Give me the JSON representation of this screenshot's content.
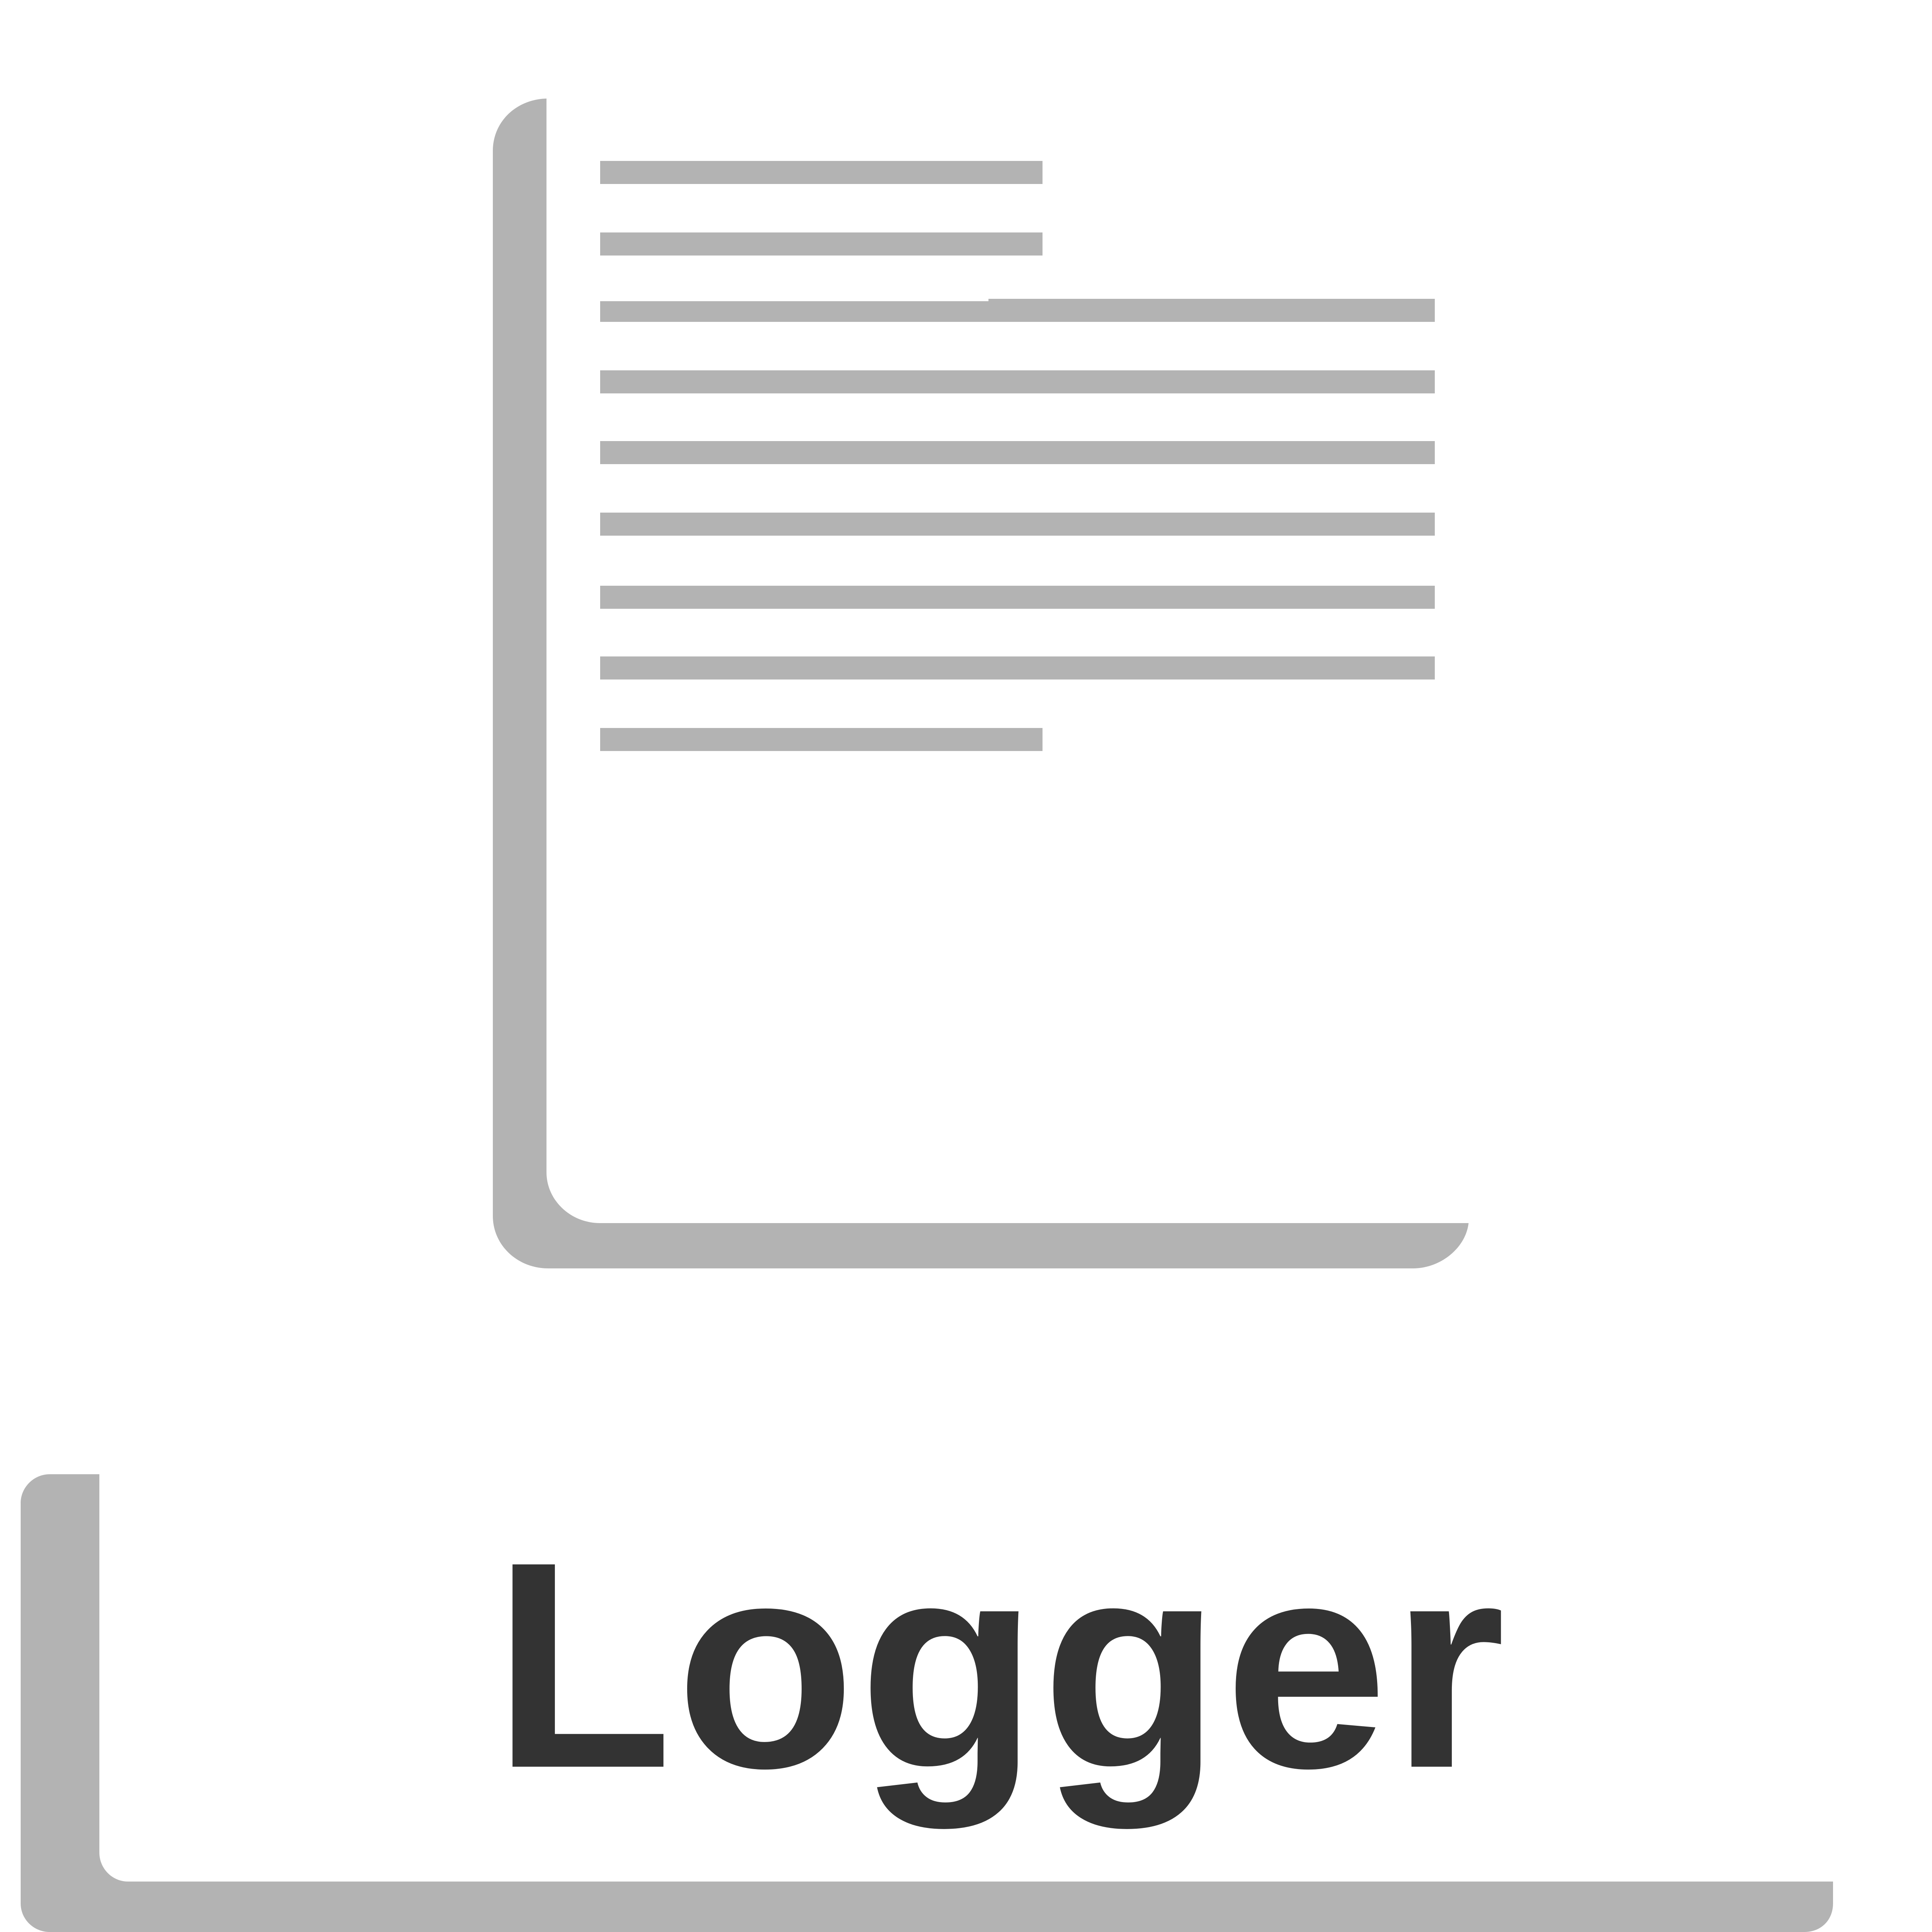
{
  "app": {
    "name": "Logger"
  },
  "icon": {
    "name": "document-icon",
    "line_count": 9
  },
  "colors": {
    "background": "#ffffff",
    "icon_gray": "#b3b3b3",
    "title_text": "#333333"
  }
}
